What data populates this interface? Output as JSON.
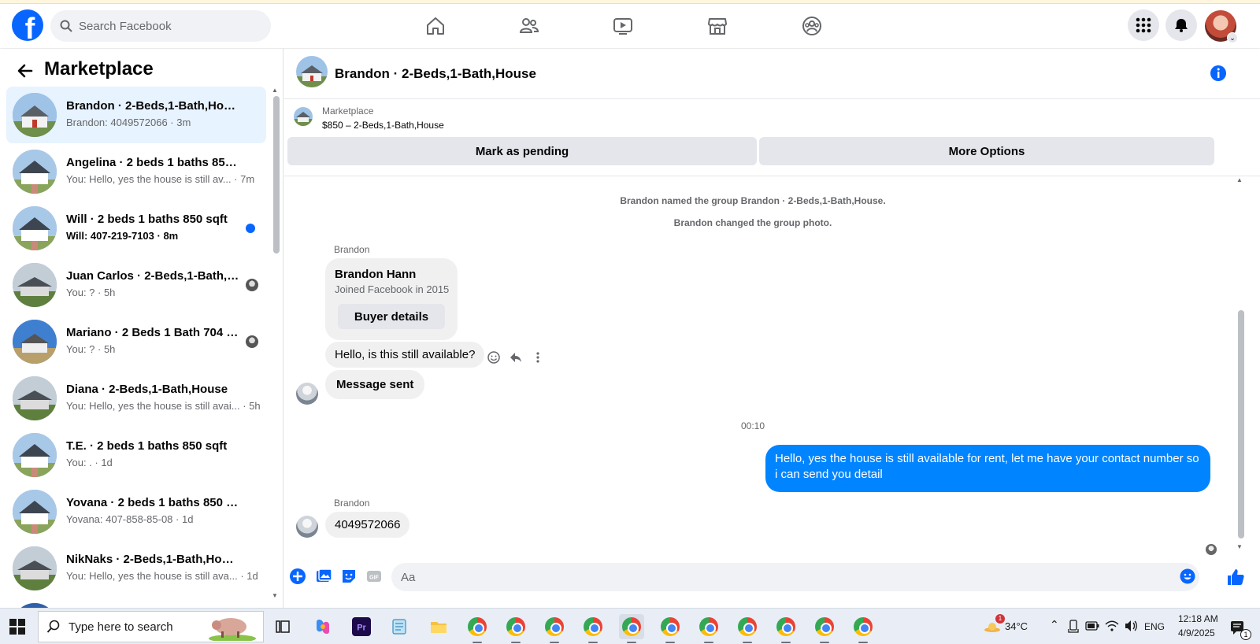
{
  "header": {
    "search_placeholder": "Search Facebook",
    "nav": [
      "home-icon",
      "friends-icon",
      "video-icon",
      "marketplace-icon",
      "groups-icon"
    ],
    "accent": "#0866ff"
  },
  "sidebar": {
    "title": "Marketplace",
    "conversations": [
      {
        "name": "Brandon · 2-Beds,1-Bath,House",
        "sub": "Brandon: 4049572066 · 3m",
        "active": true
      },
      {
        "name": "Angelina · 2 beds 1 baths 850 sqft",
        "sub": "You: Hello, yes the house is still av... · 7m"
      },
      {
        "name": "Will · 2 beds 1 baths 850 sqft",
        "sub": "Will: 407-219-7103 · 8m",
        "unread": true
      },
      {
        "name": "Juan Carlos · 2-Beds,1-Bath,H...",
        "sub": "You: ? · 5h"
      },
      {
        "name": "Mariano · 2 Beds 1 Bath 704 S...",
        "sub": "You: ? · 5h"
      },
      {
        "name": "Diana · 2-Beds,1-Bath,House",
        "sub": "You: Hello, yes the house is still avai... · 5h"
      },
      {
        "name": "T.E. · 2 beds 1 baths 850 sqft",
        "sub": "You: . · 1d"
      },
      {
        "name": "Yovana · 2 beds 1 baths 850 sqft",
        "sub": "Yovana: 407-858-85-08 · 1d"
      },
      {
        "name": "NikNaks · 2-Beds,1-Bath,House",
        "sub": "You: Hello, yes the house is still ava... · 1d"
      }
    ]
  },
  "chat": {
    "title": "Brandon · 2-Beds,1-Bath,House",
    "listing_label": "Marketplace",
    "listing_price": "$850 – 2-Beds,1-Bath,House",
    "mark_pending": "Mark as pending",
    "more_options": "More Options",
    "system_1": "Brandon named the group Brandon · 2-Beds,1-Bath,House.",
    "system_2": "Brandon changed the group photo.",
    "sender_1": "Brandon",
    "card_name": "Brandon Hann",
    "card_joined": "Joined Facebook in 2015",
    "card_button": "Buyer details",
    "msg_1": "Hello, is this still available?",
    "msg_2": "Message sent",
    "timestamp": "00:10",
    "msg_out": "Hello, yes the house is still available for rent, let me have your contact number so i can send you detail",
    "sender_2": "Brandon",
    "msg_3": "4049572066",
    "composer_placeholder": "Aa",
    "bubble_out_color": "#0084ff"
  },
  "taskbar": {
    "search_placeholder": "Type here to search",
    "weather": "34°C",
    "lang": "ENG",
    "time": "12:18 AM",
    "date": "4/9/2025",
    "weather_badge": "1",
    "notif_badge": "1"
  }
}
